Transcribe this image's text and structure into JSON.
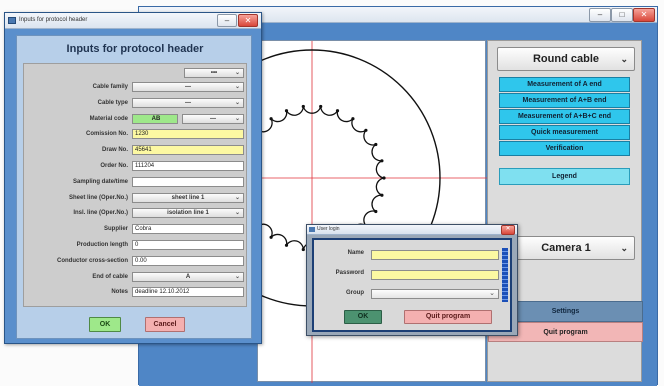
{
  "main_window": {
    "title": "",
    "caption_buttons": {
      "minimize": "–",
      "maximize": "□",
      "close": "✕"
    },
    "right_panel": {
      "cable_type_select": "Round cable",
      "buttons": [
        "Measurement of A end",
        "Measurement of A+B end",
        "Measurement of A+B+C end",
        "Quick measurement",
        "Verification"
      ],
      "legend_button": "Legend",
      "camera_select": "Camera 1",
      "settings_button": "Settings",
      "quit_button": "Quit program"
    }
  },
  "protocol_dialog": {
    "title": "Inputs for protocol header",
    "heading": "Inputs for protocol header",
    "top_dropdown": "•••",
    "fields": [
      {
        "label": "Cable family",
        "kind": "dropdown",
        "value": "—"
      },
      {
        "label": "Cable type",
        "kind": "dropdown",
        "value": "—"
      },
      {
        "label": "Material code",
        "kind": "material",
        "code": "AB",
        "value": "—"
      },
      {
        "label": "Comission No.",
        "kind": "text",
        "value": "1230",
        "highlight": true
      },
      {
        "label": "Draw No.",
        "kind": "text",
        "value": "45641",
        "highlight": true
      },
      {
        "label": "Order No.",
        "kind": "text",
        "value": "111204",
        "highlight": false
      },
      {
        "label": "Sampling date/time",
        "kind": "text",
        "value": "",
        "highlight": false
      },
      {
        "label": "Sheet line (Oper.No.)",
        "kind": "dropdown",
        "value": "sheet line 1"
      },
      {
        "label": "Insl. line (Oper.No.)",
        "kind": "dropdown",
        "value": "isolation line 1"
      },
      {
        "label": "Supplier",
        "kind": "text",
        "value": "Cobra",
        "highlight": false
      },
      {
        "label": "Production length",
        "kind": "text",
        "value": "0",
        "highlight": false
      },
      {
        "label": "Conductor cross-section",
        "kind": "text",
        "value": "0.00",
        "highlight": false
      },
      {
        "label": "End of cable",
        "kind": "dropdown",
        "value": "A"
      },
      {
        "label": "Notes",
        "kind": "text",
        "value": "deadline 12.10.2012",
        "highlight": false
      }
    ],
    "ok_button": "OK",
    "cancel_button": "Cancel"
  },
  "login_dialog": {
    "title": "User login",
    "name_label": "Name",
    "password_label": "Password",
    "group_label": "Group",
    "name_value": "",
    "password_value": "",
    "group_value": "",
    "ok_button": "OK",
    "quit_button": "Quit program"
  },
  "colors": {
    "app_blue": "#4f86c6",
    "cyan_button": "#2fc6ec",
    "input_yellow": "#fcf8a2",
    "ok_green": "#9ee88a",
    "cancel_pink": "#f4b0b0",
    "crosshair": "#e0323a"
  }
}
